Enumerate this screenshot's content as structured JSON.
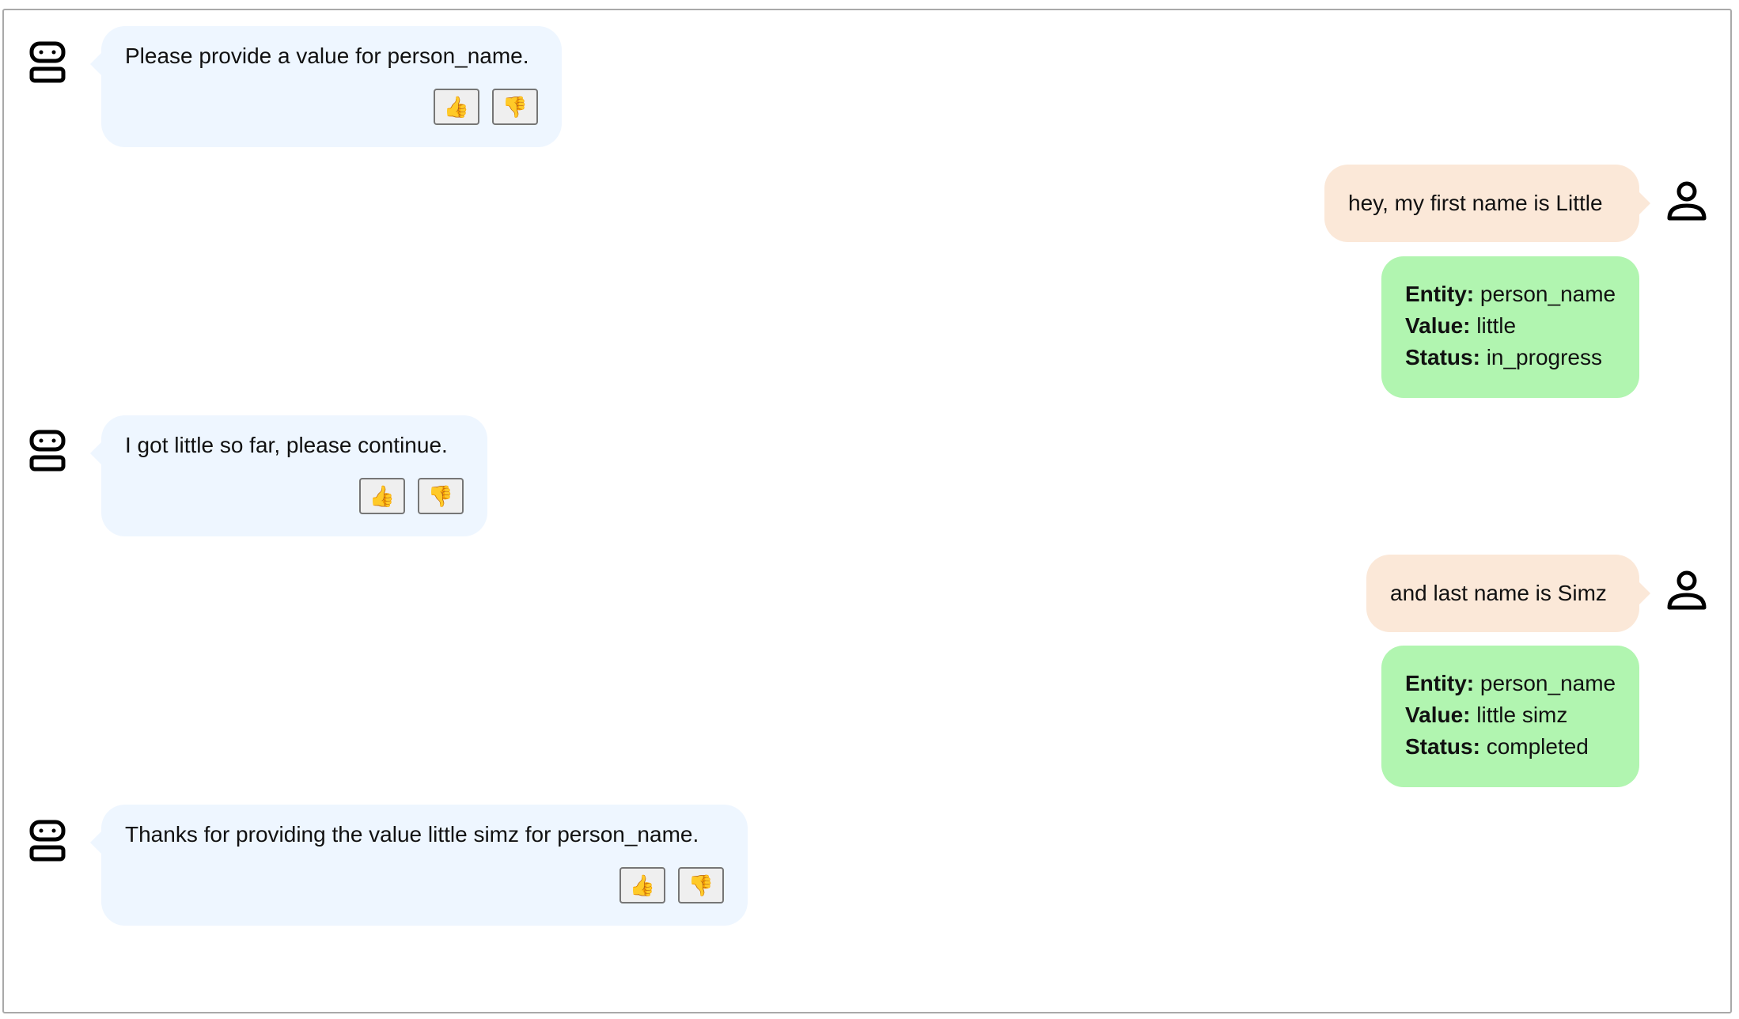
{
  "messages": [
    {
      "role": "bot",
      "text": "Please provide a value for person_name."
    },
    {
      "role": "user",
      "text": "hey, my first name is Little"
    },
    {
      "role": "slot",
      "entity_label": "Entity:",
      "entity": "person_name",
      "value_label": "Value:",
      "value": "little",
      "status_label": "Status:",
      "status": "in_progress"
    },
    {
      "role": "bot",
      "text": "I got little so far, please continue."
    },
    {
      "role": "user",
      "text": "and last name is Simz"
    },
    {
      "role": "slot",
      "entity_label": "Entity:",
      "entity": "person_name",
      "value_label": "Value:",
      "value": "little simz",
      "status_label": "Status:",
      "status": "completed"
    },
    {
      "role": "bot",
      "text": "Thanks for providing the value little simz for person_name."
    }
  ],
  "feedback": {
    "thumbs_up": "👍",
    "thumbs_down": "👎"
  },
  "icons": {
    "bot": "robot-icon",
    "user": "person-icon"
  },
  "colors": {
    "bot_bubble": "#eef6ff",
    "user_bubble": "#fbe8d8",
    "slot_card": "#b1f5b0",
    "frame_border": "#a9a9a9"
  }
}
